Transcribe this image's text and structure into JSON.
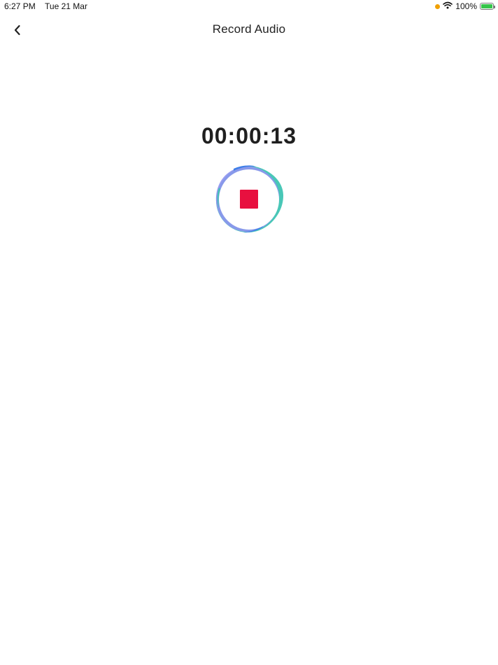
{
  "status_bar": {
    "time": "6:27 PM",
    "date": "Tue 21 Mar",
    "battery": "100%",
    "icons": [
      "orange-dot-indicator",
      "wifi-icon",
      "battery-charging-icon"
    ]
  },
  "header": {
    "title": "Record Audio",
    "back_icon": "chevron-left-icon"
  },
  "recorder": {
    "elapsed": "00:00:13",
    "stop_icon": "stop-icon",
    "colors": {
      "stop": "#e8103f",
      "wave_teal": "#3fc4b3",
      "wave_violet": "#8f93f0",
      "wave_blue": "#3f7fe8"
    }
  }
}
